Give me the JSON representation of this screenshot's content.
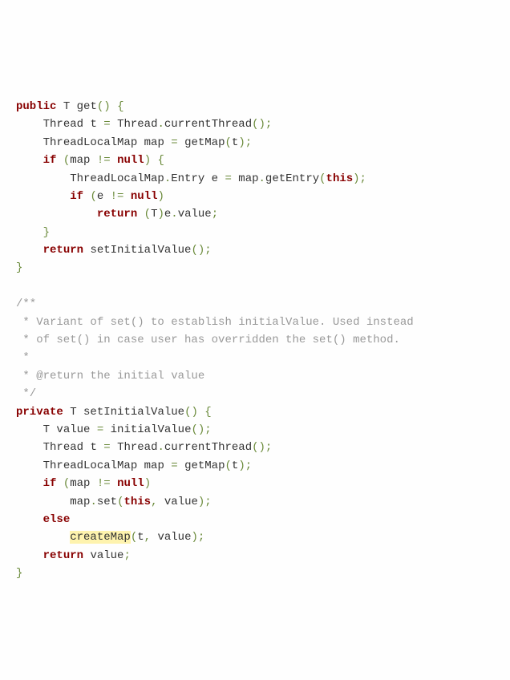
{
  "code": {
    "line1": {
      "kw1": "public",
      "type": "T",
      "method": "get",
      "paren": "() {"
    },
    "line2": {
      "indent": "    ",
      "type1": "Thread",
      "var1": "t",
      "op": "=",
      "type2": "Thread",
      "dot": ".",
      "method": "currentThread",
      "paren": "();"
    },
    "line3": {
      "indent": "    ",
      "type": "ThreadLocalMap",
      "var": "map",
      "op": "=",
      "method": "getMap",
      "lparen": "(",
      "arg": "t",
      "rparen": ");"
    },
    "line4": {
      "indent": "    ",
      "kw": "if",
      "lparen": "(",
      "var": "map",
      "op": "!=",
      "nul": "null",
      "rparen": ") {"
    },
    "line5": {
      "indent": "        ",
      "type": "ThreadLocalMap",
      "dot": ".",
      "type2": "Entry",
      "var": "e",
      "op": "=",
      "var2": "map",
      "dot2": ".",
      "method": "getEntry",
      "lparen": "(",
      "this": "this",
      "rparen": ");"
    },
    "line6": {
      "indent": "        ",
      "kw": "if",
      "lparen": "(",
      "var": "e",
      "op": "!=",
      "nul": "null",
      "rparen": ")"
    },
    "line7": {
      "indent": "            ",
      "kw": "return",
      "lparen": "(",
      "type": "T",
      "rparen": ")",
      "var": "e",
      "dot": ".",
      "prop": "value",
      "semi": ";"
    },
    "line8": {
      "indent": "    ",
      "brace": "}"
    },
    "line9": {
      "indent": "    ",
      "kw": "return",
      "method": "setInitialValue",
      "paren": "();"
    },
    "line10": {
      "brace": "}"
    },
    "comment1": "/**",
    "comment2": " * Variant of set() to establish initialValue. Used instead",
    "comment3": " * of set() in case user has overridden the set() method.",
    "comment4": " *",
    "comment5": " * @return the initial value",
    "comment6": " */",
    "line17": {
      "kw1": "private",
      "type": "T",
      "method": "setInitialValue",
      "paren": "() {"
    },
    "line18": {
      "indent": "    ",
      "type": "T",
      "var": "value",
      "op": "=",
      "method": "initialValue",
      "paren": "();"
    },
    "line19": {
      "indent": "    ",
      "type1": "Thread",
      "var1": "t",
      "op": "=",
      "type2": "Thread",
      "dot": ".",
      "method": "currentThread",
      "paren": "();"
    },
    "line20": {
      "indent": "    ",
      "type": "ThreadLocalMap",
      "var": "map",
      "op": "=",
      "method": "getMap",
      "lparen": "(",
      "arg": "t",
      "rparen": ");"
    },
    "line21": {
      "indent": "    ",
      "kw": "if",
      "lparen": "(",
      "var": "map",
      "op": "!=",
      "nul": "null",
      "rparen": ")"
    },
    "line22": {
      "indent": "        ",
      "var": "map",
      "dot": ".",
      "method": "set",
      "lparen": "(",
      "this": "this",
      "comma": ",",
      "arg": "value",
      "rparen": ");"
    },
    "line23": {
      "indent": "    ",
      "kw": "else"
    },
    "line24": {
      "indent": "        ",
      "method": "createMap",
      "lparen": "(",
      "arg1": "t",
      "comma": ",",
      "arg2": "value",
      "rparen": ");"
    },
    "line25": {
      "indent": "    ",
      "kw": "return",
      "var": "value",
      "semi": ";"
    },
    "line26": {
      "brace": "}"
    }
  }
}
